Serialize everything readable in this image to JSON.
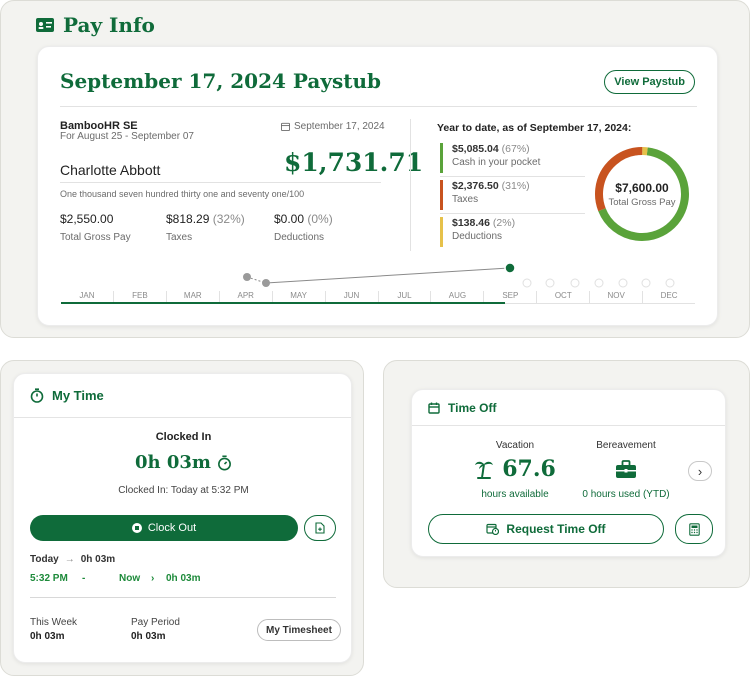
{
  "pay_info": {
    "title": "Pay Info",
    "paystub": {
      "title": "September 17, 2024 Paystub",
      "view_label": "View Paystub",
      "company": "BambooHR SE",
      "period": "For August 25 - September 07",
      "date": "September 17, 2024",
      "employee": "Charlotte Abbott",
      "net_pay": "$1,731.71",
      "amount_words": "One thousand seven hundred thirty one and seventy one/100",
      "stats": [
        {
          "value": "$2,550.00",
          "pct": "",
          "label": "Total Gross Pay"
        },
        {
          "value": "$818.29",
          "pct": "(32%)",
          "label": "Taxes"
        },
        {
          "value": "$0.00",
          "pct": "(0%)",
          "label": "Deductions"
        }
      ],
      "ytd_title": "Year to date, as of September 17, 2024:",
      "ytd_items": [
        {
          "value": "$5,085.04",
          "pct": "(67%)",
          "label": "Cash in your pocket",
          "color": "#5aa33a"
        },
        {
          "value": "$2,376.50",
          "pct": "(31%)",
          "label": "Taxes",
          "color": "#c8531f"
        },
        {
          "value": "$138.46",
          "pct": "(2%)",
          "label": "Deductions",
          "color": "#e6c14a"
        }
      ],
      "donut": {
        "total": "$7,600.00",
        "label": "Total Gross Pay",
        "fractions": [
          0.67,
          0.31,
          0.02
        ],
        "colors": [
          "#5aa33a",
          "#c8531f",
          "#e6c14a"
        ]
      },
      "months": [
        "JAN",
        "FEB",
        "MAR",
        "APR",
        "MAY",
        "JUN",
        "JUL",
        "AUG",
        "SEP",
        "OCT",
        "NOV",
        "DEC"
      ],
      "timeline_progress": 0.7
    }
  },
  "my_time": {
    "title": "My Time",
    "status": "Clocked In",
    "duration": "0h 03m",
    "clocked_in_text": "Clocked In: Today at 5:32 PM",
    "clock_out_label": "Clock Out",
    "today_label": "Today",
    "today_total": "0h 03m",
    "entry_start": "5:32 PM",
    "entry_dash": "-",
    "entry_end": "Now",
    "entry_duration": "0h 03m",
    "week_label": "This Week",
    "week_value": "0h 03m",
    "period_label": "Pay Period",
    "period_value": "0h 03m",
    "timesheet_label": "My Timesheet"
  },
  "time_off": {
    "title": "Time Off",
    "vacation_label": "Vacation",
    "vacation_value": "67.6",
    "vacation_sub": "hours available",
    "bereavement_label": "Bereavement",
    "bereavement_sub": "0 hours used (YTD)",
    "request_label": "Request Time Off"
  },
  "colors": {
    "brand": "#0f6b3a",
    "green": "#5aa33a",
    "orange": "#c8531f",
    "yellow": "#e6c14a"
  }
}
